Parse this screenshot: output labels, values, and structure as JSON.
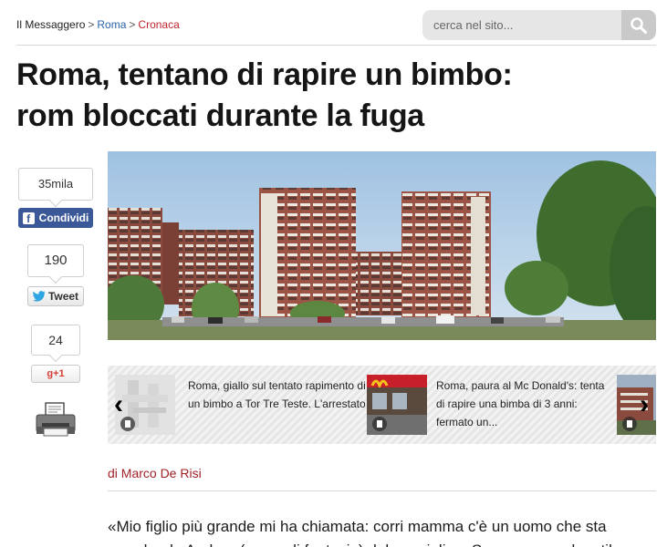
{
  "breadcrumb": {
    "site": "Il Messaggero",
    "separator": ">",
    "section": "Roma",
    "subsection": "Cronaca"
  },
  "search": {
    "placeholder": "cerca nel sito...",
    "button_icon": "search-icon"
  },
  "article": {
    "headline_line1": "Roma, tentano di rapire un bimbo:",
    "headline_line2": "rom bloccati durante la fuga",
    "author": "di Marco De Risi",
    "body_lines": [
      "«Mio figlio più grande mi ha chiamata: corri mamma c'è un uomo che sta",
      "prendendo Andrea (nome di fantasia) dal seggiolino. Sono corsa nel cortile:"
    ]
  },
  "share": {
    "facebook": {
      "count": "35mila",
      "label": "Condividi",
      "icon": "facebook-icon",
      "color": "#3b5998"
    },
    "twitter": {
      "count": "190",
      "label": "Tweet",
      "icon": "twitter-bird-icon"
    },
    "gplus": {
      "count": "24",
      "label": "g+1",
      "color": "#d73d32"
    },
    "print_icon": "printer-icon"
  },
  "related": {
    "items": [
      {
        "text": "Roma, giallo sul tentato rapimento di un bimbo a Tor Tre Teste. L'arrestato"
      },
      {
        "text": "Roma, paura al Mc Donald's: tenta di rapire una bimba di 3 anni: fermato un..."
      }
    ],
    "prev_icon": "chevron-left-icon",
    "next_icon": "chevron-right-icon"
  },
  "colors": {
    "link_blue": "#2a62a8",
    "accent_red": "#c0262d",
    "author_red": "#a02128"
  }
}
